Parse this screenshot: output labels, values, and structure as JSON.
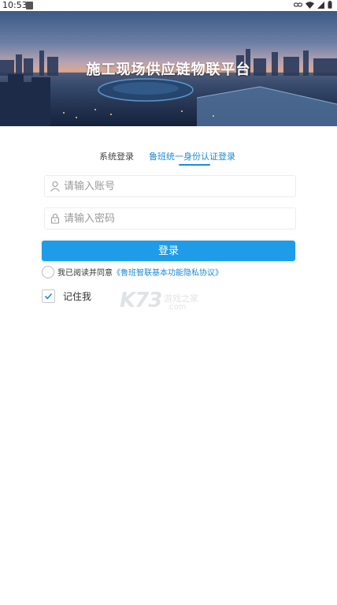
{
  "status_bar": {
    "time": "10:53"
  },
  "header": {
    "title": "施工现场供应链物联平台"
  },
  "tabs": {
    "system_login": "系统登录",
    "luban_id_login": "鲁班统一身份认证登录",
    "active": "luban_id_login"
  },
  "form": {
    "account_placeholder": "请输入账号",
    "account_value": "",
    "password_placeholder": "请输入密码",
    "password_value": "",
    "login_button": "登录"
  },
  "agreement": {
    "prefix": "我已阅读并同意",
    "link": "《鲁班智联基本功能隐私协议》",
    "checked": false
  },
  "remember": {
    "label": "记住我",
    "checked": true
  },
  "watermark": {
    "brand": "K73",
    "sub": "游戏之家",
    "domain": ".com"
  },
  "colors": {
    "accent": "#1f9ce8",
    "link": "#1c8ad9"
  }
}
